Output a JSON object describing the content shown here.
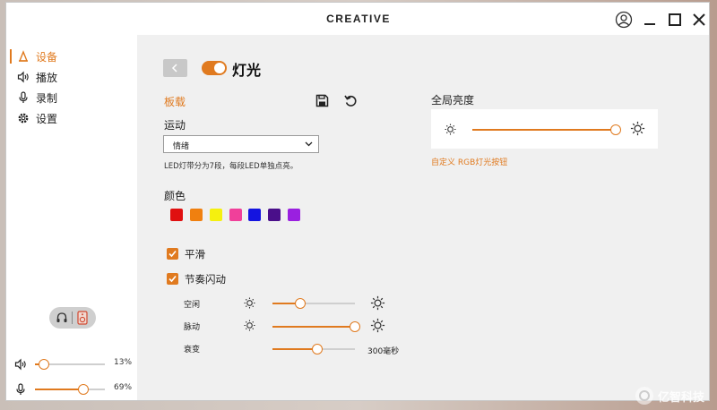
{
  "app": {
    "logo": "CREATIVE"
  },
  "window_controls": [
    "user-icon",
    "minimize-icon",
    "maximize-icon",
    "close-icon"
  ],
  "sidebar": {
    "items": [
      {
        "label": "设备",
        "icon": "device-icon",
        "active": true
      },
      {
        "label": "播放",
        "icon": "speaker-icon",
        "active": false
      },
      {
        "label": "录制",
        "icon": "microphone-icon",
        "active": false
      },
      {
        "label": "设置",
        "icon": "gear-icon",
        "active": false
      }
    ],
    "device_switch": {
      "left_icon": "headphone-icon",
      "right_icon": "speaker-device-icon",
      "selected": "speaker"
    },
    "volume": {
      "icon": "speaker-icon",
      "level": 13,
      "value_text": "13%"
    },
    "mic": {
      "icon": "microphone-icon",
      "level": 69,
      "value_text": "69%"
    }
  },
  "main": {
    "title": "灯光",
    "toggle_on": true,
    "onboard": {
      "label": "板载"
    },
    "motion": {
      "label": "运动",
      "selected": "情绪",
      "hint": "LED灯带分为7段，每段LED单独点亮。"
    },
    "colors": {
      "label": "颜色",
      "swatches": [
        "#e01010",
        "#f0800f",
        "#f5f00f",
        "#f0409a",
        "#1414e0",
        "#4a0f8a",
        "#9a20e0"
      ]
    },
    "smooth": {
      "label": "平滑",
      "checked": true
    },
    "rhythm": {
      "label": "节奏闪动",
      "checked": true,
      "idle": {
        "label": "空闲",
        "level": 0.34
      },
      "pulse": {
        "label": "脉动",
        "level": 1.0
      },
      "decay": {
        "label": "衰变",
        "level": 0.54,
        "value_text": "300毫秒"
      }
    },
    "global_brightness": {
      "label": "全局亮度",
      "level": 1.0
    },
    "custom_rgb": {
      "label": "自定义 RGB灯光按钮"
    }
  },
  "accent_color": "#e07a1f",
  "watermark": {
    "text": "亿智科技"
  }
}
